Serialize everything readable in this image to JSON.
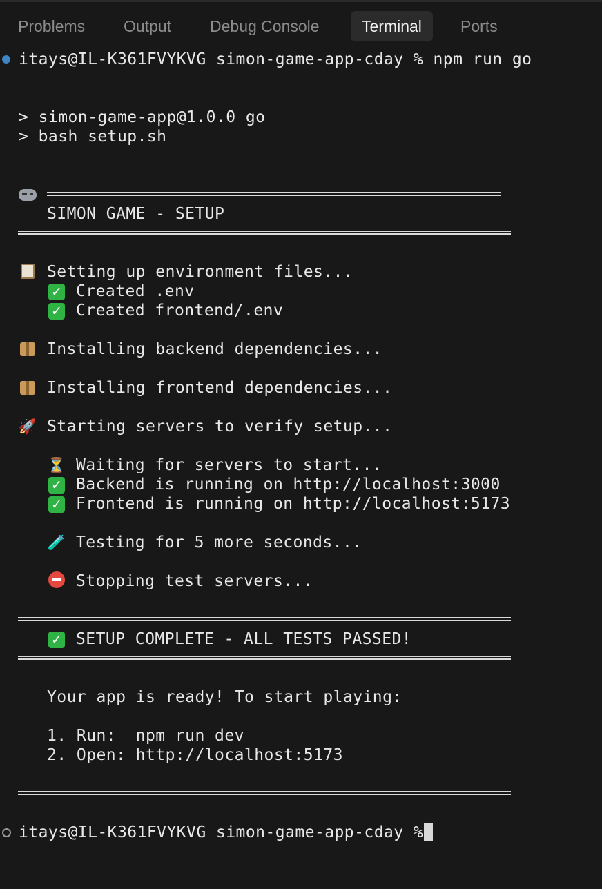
{
  "panel": {
    "tabs": [
      "Problems",
      "Output",
      "Debug Console",
      "Terminal",
      "Ports"
    ],
    "active_tab": "Terminal"
  },
  "terminal": {
    "prompt_command": "itays@IL-K361FVYKVG simon-game-app-cday % npm run go",
    "script_line1": "> simon-game-app@1.0.0 go",
    "script_line2": "> bash setup.sh",
    "header_title": "SIMON GAME - SETUP",
    "env_heading": "Setting up environment files...",
    "env_created1": "Created .env",
    "env_created2": "Created frontend/.env",
    "backend_install": "Installing backend dependencies...",
    "frontend_install": "Installing frontend dependencies...",
    "starting": "Starting servers to verify setup...",
    "waiting": "Waiting for servers to start...",
    "backend_running": "Backend is running on http://localhost:3000",
    "frontend_running": "Frontend is running on http://localhost:5173",
    "testing": "Testing for 5 more seconds...",
    "stopping": "Stopping test servers...",
    "complete": "SETUP COMPLETE - ALL TESTS PASSED!",
    "ready": "Your app is ready! To start playing:",
    "step1": "1. Run:  npm run dev",
    "step2": "2. Open: http://localhost:5173",
    "prompt_final": "itays@IL-K361FVYKVG simon-game-app-cday % "
  },
  "icons": {
    "gamepad": "gamepad-icon",
    "clipboard": "clipboard-icon",
    "check": "check-mark-icon",
    "package": "package-icon",
    "rocket": "rocket-icon",
    "hourglass": "hourglass-icon",
    "test_tube": "test-tube-icon",
    "stop": "stop-sign-icon"
  },
  "colors": {
    "background": "#181818",
    "text": "#e8e8e8",
    "tab_inactive": "#8b8b8b",
    "prompt_dot": "#3b86c3",
    "check_green": "#2fb344",
    "stop_red": "#e5483f"
  }
}
